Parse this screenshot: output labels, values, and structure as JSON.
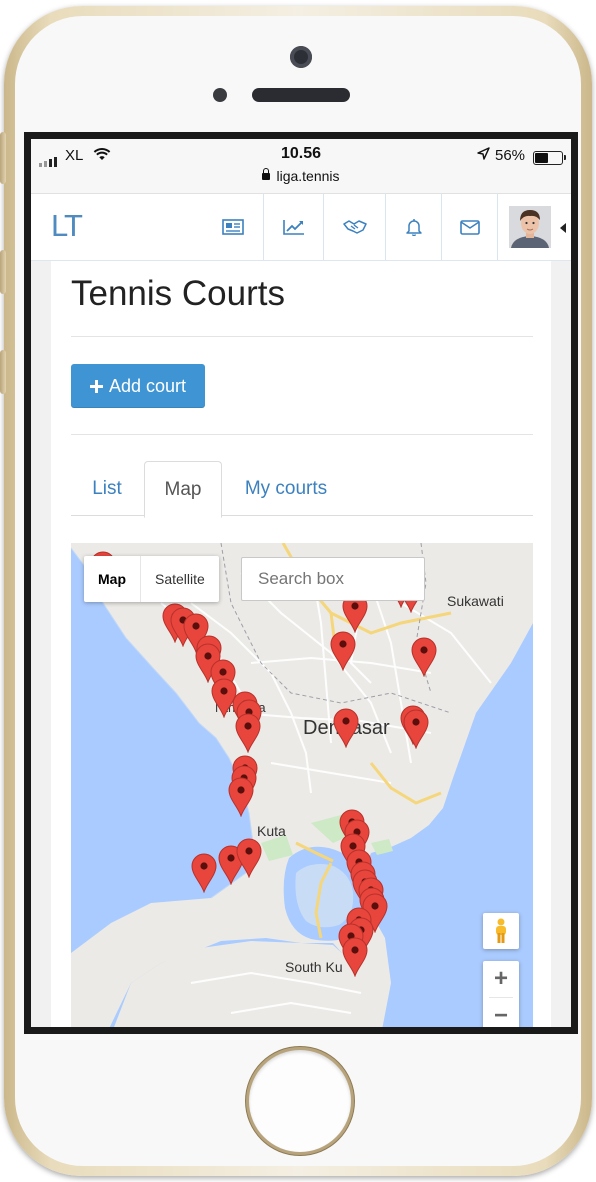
{
  "status_bar": {
    "carrier": "XL",
    "time": "10.56",
    "url": "liga.tennis",
    "battery_percent": "56%",
    "battery_level": 0.56
  },
  "nav": {
    "logo": "LT",
    "icons": [
      "newspaper-icon",
      "chart-line-icon",
      "handshake-icon",
      "bell-icon",
      "envelope-icon"
    ]
  },
  "page": {
    "title": "Tennis Courts",
    "add_button": "Add court",
    "tabs": [
      {
        "label": "List",
        "active": false
      },
      {
        "label": "Map",
        "active": true
      },
      {
        "label": "My courts",
        "active": false
      }
    ]
  },
  "map": {
    "type_map": "Map",
    "type_satellite": "Satellite",
    "search_placeholder": "Search box",
    "labels": {
      "sukawati": "Sukawati",
      "denpasar": "Denpasar",
      "north_kuta": "Nth Kuta",
      "kuta": "Kuta",
      "south_kuta": "South Ku"
    },
    "zoom_in": "+",
    "zoom_out": "−"
  },
  "colors": {
    "brand": "#3f95d3",
    "link": "#3c81bf",
    "marker": "#e8453c",
    "water": "#aacbff",
    "land": "#eaeaea"
  }
}
